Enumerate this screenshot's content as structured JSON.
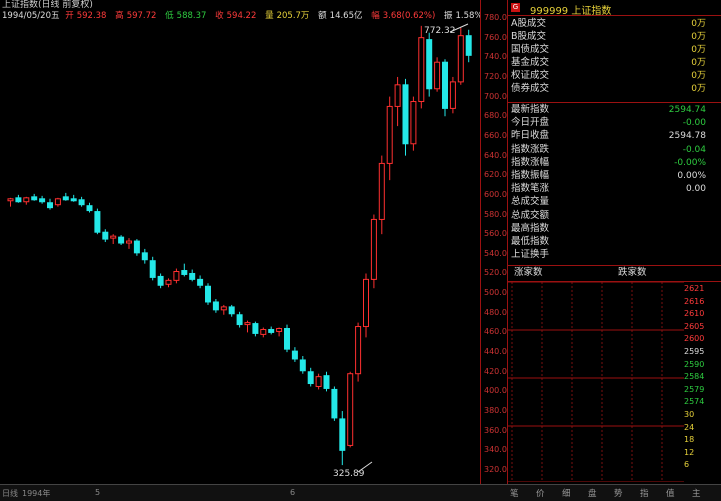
{
  "header": {
    "title": "上证指数(日线 前复权)",
    "date": "1994/05/20五",
    "open_label": "开",
    "open": "592.38",
    "high_label": "高",
    "high": "597.72",
    "low_label": "低",
    "low": "588.37",
    "close_label": "收",
    "close": "594.22",
    "vol_label": "量",
    "vol": "205.7万",
    "amt_label": "额",
    "amt": "14.65亿",
    "chg_label": "幅",
    "chg": "3.68(0.62%)",
    "turn_label": "振",
    "turn": "1.58%"
  },
  "annotations": {
    "high_mark": "772.32",
    "low_mark": "325.89"
  },
  "price_ticks": [
    "780.00",
    "760.00",
    "740.00",
    "720.00",
    "700.00",
    "680.00",
    "660.00",
    "640.00",
    "620.00",
    "600.00",
    "580.00",
    "560.00",
    "540.00",
    "520.00",
    "500.00",
    "480.00",
    "460.00",
    "440.00",
    "420.00",
    "400.00",
    "380.00",
    "360.00",
    "340.00",
    "320.00"
  ],
  "panel": {
    "badge": "G",
    "code": "999999",
    "name": "上证指数",
    "trade_rows": [
      {
        "label": "A股成交",
        "value": "0万"
      },
      {
        "label": "B股成交",
        "value": "0万"
      },
      {
        "label": "国债成交",
        "value": "0万"
      },
      {
        "label": "基金成交",
        "value": "0万"
      },
      {
        "label": "权证成交",
        "value": "0万"
      },
      {
        "label": "债券成交",
        "value": "0万"
      }
    ],
    "stats": [
      {
        "label": "最新指数",
        "value": "2594.74",
        "color": "#2ecc40"
      },
      {
        "label": "今日开盘",
        "value": "-0.00",
        "color": "#2ecc40"
      },
      {
        "label": "昨日收盘",
        "value": "2594.78",
        "color": "#ddd"
      },
      {
        "label": "指数涨跌",
        "value": "-0.04",
        "color": "#2ecc40"
      },
      {
        "label": "指数涨幅",
        "value": "-0.00%",
        "color": "#2ecc40"
      },
      {
        "label": "指数振幅",
        "value": "0.00%",
        "color": "#ddd"
      },
      {
        "label": "指数笔涨",
        "value": "0.00",
        "color": "#ddd"
      },
      {
        "label": "总成交量",
        "value": "",
        "color": "#ddd"
      },
      {
        "label": "总成交额",
        "value": "",
        "color": "#ddd"
      },
      {
        "label": "最高指数",
        "value": "",
        "color": "#ddd"
      },
      {
        "label": "最低指数",
        "value": "",
        "color": "#ddd"
      },
      {
        "label": "上证换手",
        "value": "",
        "color": "#ddd"
      }
    ],
    "rise_label": "涨家数",
    "fall_label": "跌家数",
    "mini_scale": [
      "2621",
      "2616",
      "2610",
      "2605",
      "2600",
      "2595",
      "2590",
      "2584",
      "2579",
      "2574",
      "30",
      "24",
      "18",
      "12",
      "6"
    ]
  },
  "bottom_tabs": [
    "笔",
    "价",
    "细",
    "盘",
    "势",
    "指",
    "值",
    "主"
  ],
  "x_labels": [
    "日线",
    "1994年",
    "5",
    "6"
  ],
  "ohlc": [
    {
      "o": 594,
      "h": 597,
      "l": 588,
      "c": 596
    },
    {
      "o": 597,
      "h": 600,
      "l": 592,
      "c": 593
    },
    {
      "o": 593,
      "h": 598,
      "l": 590,
      "c": 597
    },
    {
      "o": 598,
      "h": 601,
      "l": 594,
      "c": 595
    },
    {
      "o": 596,
      "h": 599,
      "l": 591,
      "c": 593
    },
    {
      "o": 592,
      "h": 596,
      "l": 585,
      "c": 587
    },
    {
      "o": 590,
      "h": 597,
      "l": 588,
      "c": 596
    },
    {
      "o": 598,
      "h": 602,
      "l": 594,
      "c": 595
    },
    {
      "o": 596,
      "h": 600,
      "l": 593,
      "c": 594
    },
    {
      "o": 595,
      "h": 598,
      "l": 588,
      "c": 590
    },
    {
      "o": 589,
      "h": 592,
      "l": 582,
      "c": 584
    },
    {
      "o": 583,
      "h": 586,
      "l": 560,
      "c": 562
    },
    {
      "o": 562,
      "h": 565,
      "l": 552,
      "c": 555
    },
    {
      "o": 556,
      "h": 560,
      "l": 550,
      "c": 558
    },
    {
      "o": 557,
      "h": 559,
      "l": 549,
      "c": 551
    },
    {
      "o": 551,
      "h": 556,
      "l": 545,
      "c": 553
    },
    {
      "o": 553,
      "h": 555,
      "l": 538,
      "c": 541
    },
    {
      "o": 541,
      "h": 545,
      "l": 530,
      "c": 534
    },
    {
      "o": 533,
      "h": 537,
      "l": 513,
      "c": 516
    },
    {
      "o": 517,
      "h": 520,
      "l": 505,
      "c": 508
    },
    {
      "o": 509,
      "h": 515,
      "l": 506,
      "c": 513
    },
    {
      "o": 513,
      "h": 525,
      "l": 510,
      "c": 522
    },
    {
      "o": 523,
      "h": 530,
      "l": 517,
      "c": 519
    },
    {
      "o": 520,
      "h": 524,
      "l": 512,
      "c": 514
    },
    {
      "o": 514,
      "h": 518,
      "l": 505,
      "c": 508
    },
    {
      "o": 507,
      "h": 510,
      "l": 488,
      "c": 491
    },
    {
      "o": 491,
      "h": 494,
      "l": 480,
      "c": 483
    },
    {
      "o": 483,
      "h": 488,
      "l": 478,
      "c": 486
    },
    {
      "o": 486,
      "h": 488,
      "l": 476,
      "c": 479
    },
    {
      "o": 478,
      "h": 481,
      "l": 465,
      "c": 468
    },
    {
      "o": 468,
      "h": 472,
      "l": 460,
      "c": 470
    },
    {
      "o": 469,
      "h": 471,
      "l": 456,
      "c": 459
    },
    {
      "o": 458,
      "h": 465,
      "l": 455,
      "c": 463
    },
    {
      "o": 463,
      "h": 466,
      "l": 458,
      "c": 460
    },
    {
      "o": 461,
      "h": 465,
      "l": 456,
      "c": 464
    },
    {
      "o": 464,
      "h": 468,
      "l": 440,
      "c": 443
    },
    {
      "o": 441,
      "h": 445,
      "l": 430,
      "c": 433
    },
    {
      "o": 432,
      "h": 436,
      "l": 418,
      "c": 421
    },
    {
      "o": 420,
      "h": 424,
      "l": 405,
      "c": 408
    },
    {
      "o": 405,
      "h": 418,
      "l": 402,
      "c": 415
    },
    {
      "o": 416,
      "h": 420,
      "l": 400,
      "c": 403
    },
    {
      "o": 402,
      "h": 405,
      "l": 370,
      "c": 373
    },
    {
      "o": 372,
      "h": 380,
      "l": 325,
      "c": 340
    },
    {
      "o": 345,
      "h": 420,
      "l": 343,
      "c": 418
    },
    {
      "o": 418,
      "h": 470,
      "l": 410,
      "c": 466
    },
    {
      "o": 466,
      "h": 520,
      "l": 455,
      "c": 514
    },
    {
      "o": 514,
      "h": 580,
      "l": 505,
      "c": 575
    },
    {
      "o": 575,
      "h": 640,
      "l": 560,
      "c": 632
    },
    {
      "o": 632,
      "h": 700,
      "l": 615,
      "c": 690
    },
    {
      "o": 690,
      "h": 720,
      "l": 670,
      "c": 712
    },
    {
      "o": 712,
      "h": 718,
      "l": 640,
      "c": 652
    },
    {
      "o": 652,
      "h": 700,
      "l": 645,
      "c": 695
    },
    {
      "o": 695,
      "h": 772,
      "l": 688,
      "c": 760
    },
    {
      "o": 758,
      "h": 765,
      "l": 700,
      "c": 708
    },
    {
      "o": 708,
      "h": 740,
      "l": 705,
      "c": 735
    },
    {
      "o": 735,
      "h": 738,
      "l": 680,
      "c": 688
    },
    {
      "o": 688,
      "h": 720,
      "l": 683,
      "c": 715
    },
    {
      "o": 715,
      "h": 770,
      "l": 712,
      "c": 762
    },
    {
      "o": 762,
      "h": 768,
      "l": 735,
      "c": 742
    }
  ]
}
